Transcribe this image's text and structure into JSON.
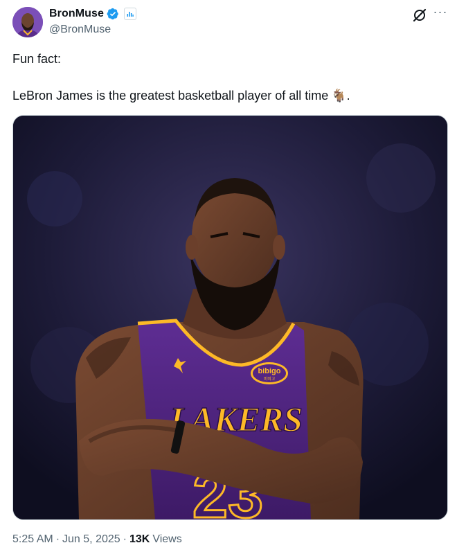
{
  "author": {
    "display_name": "BronMuse",
    "handle": "@BronMuse",
    "verified": true
  },
  "tweet": {
    "line1": "Fun fact:",
    "line2": "LeBron James is the greatest basketball player of all time",
    "emoji": "🐐",
    "line2_end": "."
  },
  "media": {
    "jersey_team": "LAKERS",
    "sponsor": "bibigo",
    "sponsor_sub": "비비고",
    "jersey_number": "23"
  },
  "meta": {
    "time": "5:25 AM",
    "sep1": "·",
    "date": "Jun 5, 2025",
    "sep2": "·",
    "views_count": "13K",
    "views_label": "Views"
  },
  "icons": {
    "verified": "verified-badge-icon",
    "affiliate": "affiliate-icon",
    "grok": "grok-icon",
    "more": "more-icon"
  },
  "colors": {
    "verified_blue": "#1d9bf0",
    "lakers_purple": "#552583",
    "lakers_gold": "#fdb927",
    "secondary_text": "#536471"
  }
}
